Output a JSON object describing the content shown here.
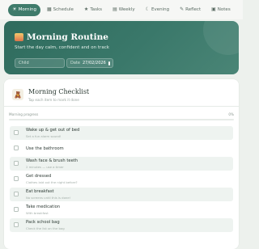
{
  "nav": {
    "tabs": [
      {
        "icon": "☀",
        "icon_name": "sun-icon",
        "label": "Morning",
        "active": true
      },
      {
        "icon": "▦",
        "icon_name": "calendar-icon",
        "label": "Schedule",
        "active": false
      },
      {
        "icon": "★",
        "icon_name": "star-icon",
        "label": "Tasks",
        "active": false
      },
      {
        "icon": "▤",
        "icon_name": "week-icon",
        "label": "Weekly",
        "active": false
      },
      {
        "icon": "☾",
        "icon_name": "moon-icon",
        "label": "Evening",
        "active": false
      },
      {
        "icon": "✎",
        "icon_name": "reflect-icon",
        "label": "Reflect",
        "active": false
      },
      {
        "icon": "▣",
        "icon_name": "notes-icon",
        "label": "Notes",
        "active": false
      }
    ]
  },
  "hero": {
    "title": "Morning Routine",
    "subtitle": "Start the day calm, confident and on track",
    "child_label": "Child",
    "child_value": "",
    "date_label": "Date",
    "date_value": "27/02/2026"
  },
  "checklist": {
    "title": "Morning Checklist",
    "subtitle": "Tap each item to mark it done",
    "progress_label": "Morning progress",
    "progress_text": "0%",
    "progress_value": 0,
    "tasks": [
      {
        "title": "Wake up & get out of bed",
        "subtitle": "Set a fun alarm sound!"
      },
      {
        "title": "Use the bathroom",
        "subtitle": ""
      },
      {
        "title": "Wash face & brush teeth",
        "subtitle": "2 minutes — use a timer"
      },
      {
        "title": "Get dressed",
        "subtitle": "Clothes laid out the night before?"
      },
      {
        "title": "Eat breakfast",
        "subtitle": "No screens until this is done!"
      },
      {
        "title": "Take medication",
        "subtitle": "With breakfast"
      },
      {
        "title": "Pack school bag",
        "subtitle": "Check the list on the bag"
      }
    ]
  },
  "colors": {
    "accent": "#3f7b6b",
    "hero_dark": "#2f6b5d",
    "background": "#edf1ed"
  }
}
